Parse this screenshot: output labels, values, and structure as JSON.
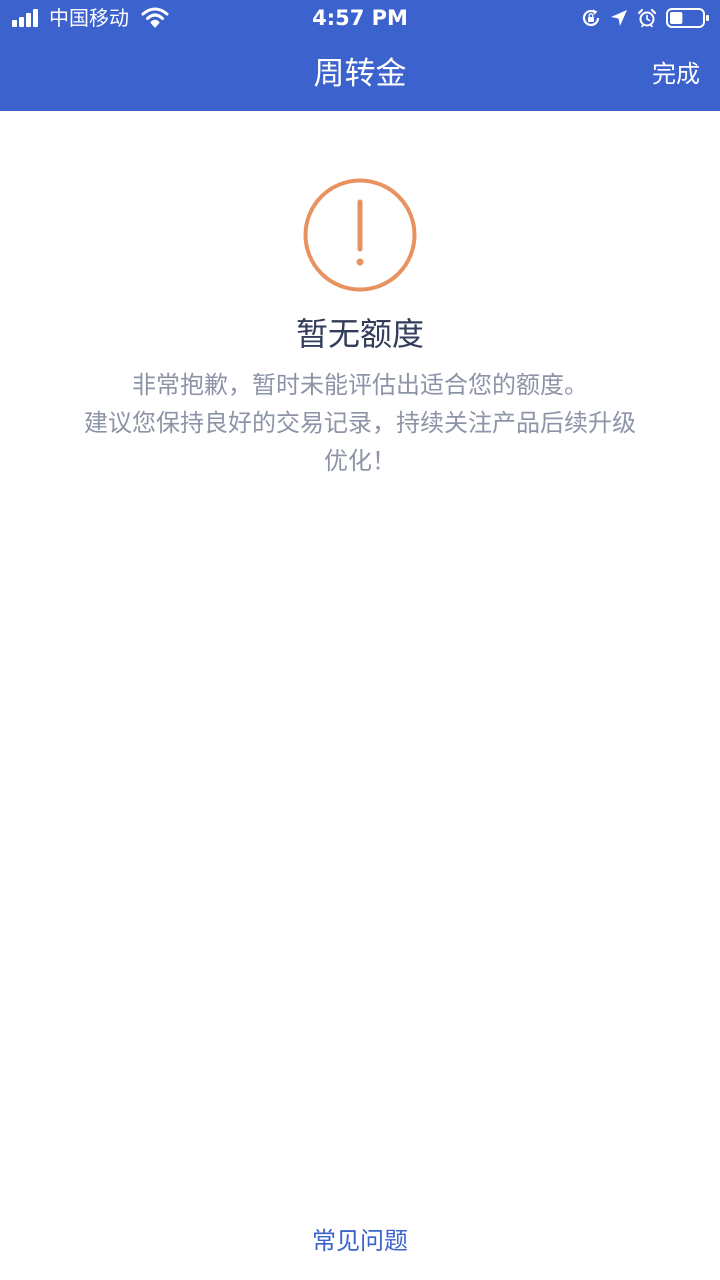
{
  "status_bar": {
    "carrier": "中国移动",
    "time": "4:57 PM",
    "signal_bars": 4,
    "battery_level": 0.4,
    "icons": [
      "signal-icon",
      "wifi-icon",
      "rotation-lock-icon",
      "location-arrow-icon",
      "alarm-icon",
      "battery-icon"
    ]
  },
  "nav": {
    "title": "周转金",
    "done_label": "完成"
  },
  "result": {
    "icon": "warning-icon",
    "title": "暂无额度",
    "message_lines": [
      "非常抱歉，暂时未能评估出适合您的额度。",
      "建议您保持良好的交易记录，持续关注产品后续升级",
      "优化！"
    ]
  },
  "footer": {
    "faq_label": "常见问题"
  },
  "colors": {
    "header_bg": "#3c62cd",
    "warning": "#e7925f",
    "title_text": "#333c5a",
    "body_text": "#8e94a7",
    "link": "#3c62cd"
  }
}
